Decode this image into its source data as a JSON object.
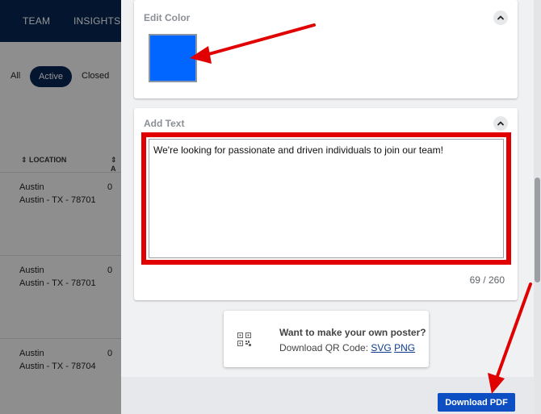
{
  "background": {
    "nav": {
      "team": "TEAM",
      "insights": "INSIGHTS"
    },
    "filters": {
      "all": "All",
      "active": "Active",
      "closed": "Closed"
    },
    "table": {
      "location_header": "⇕ LOCATION",
      "second_header": "⇕ A",
      "rows": [
        {
          "city": "Austin",
          "address": "Austin - TX - 78701",
          "number": "0"
        },
        {
          "city": "Austin",
          "address": "Austin - TX - 78701",
          "number": "0"
        },
        {
          "city": "Austin",
          "address": "Austin - TX - 78704",
          "number": "0"
        }
      ]
    }
  },
  "edit_color": {
    "title": "Edit Color",
    "selected_color": "#0066ff"
  },
  "add_text": {
    "title": "Add Text",
    "value": "We're looking for passionate and driven individuals to join our team!",
    "counter": "69 / 260"
  },
  "qr_promo": {
    "title": "Want to make your own poster?",
    "download_label": "Download QR Code:",
    "svg_link": "SVG",
    "png_link": "PNG"
  },
  "footer": {
    "download_button": "Download PDF"
  },
  "icons": {
    "collapse": "chevron-up-icon",
    "qr": "qr-code-icon"
  },
  "colors": {
    "nav": "#062552",
    "annotation": "#e10000",
    "primary_button": "#0d4fc3"
  }
}
